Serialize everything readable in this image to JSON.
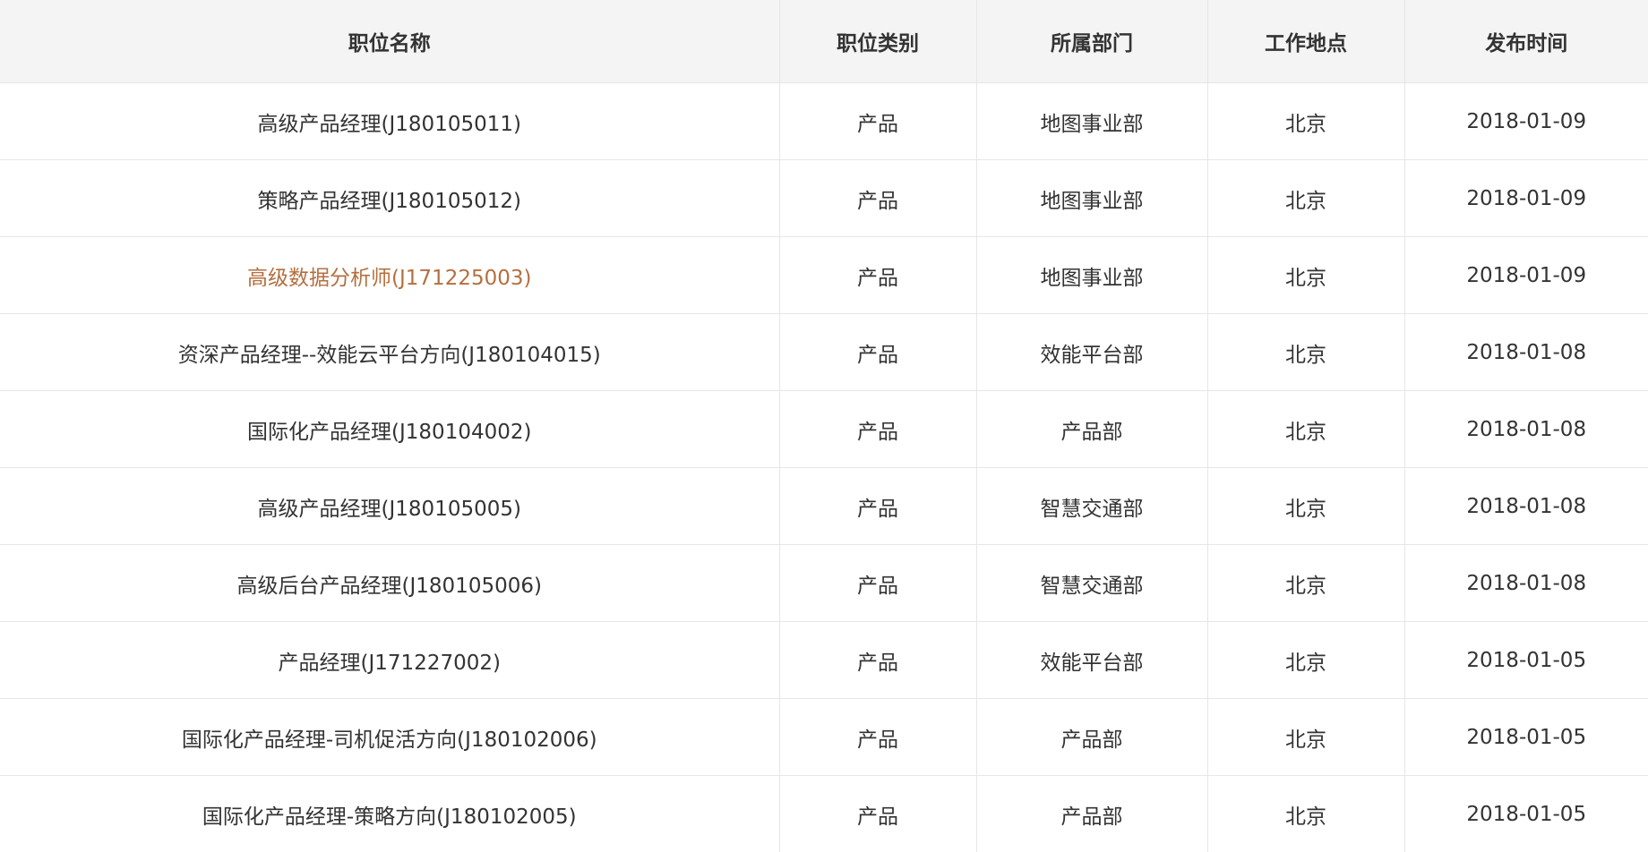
{
  "table": {
    "headers": [
      "职位名称",
      "职位类别",
      "所属部门",
      "工作地点",
      "发布时间"
    ],
    "rows": [
      {
        "title": "高级产品经理(J180105011)",
        "category": "产品",
        "department": "地图事业部",
        "location": "北京",
        "date": "2018-01-09"
      },
      {
        "title": "策略产品经理(J180105012)",
        "category": "产品",
        "department": "地图事业部",
        "location": "北京",
        "date": "2018-01-09"
      },
      {
        "title": "高级数据分析师(J171225003)",
        "category": "产品",
        "department": "地图事业部",
        "location": "北京",
        "date": "2018-01-09"
      },
      {
        "title": "资深产品经理--效能云平台方向(J180104015)",
        "category": "产品",
        "department": "效能平台部",
        "location": "北京",
        "date": "2018-01-08"
      },
      {
        "title": "国际化产品经理(J180104002)",
        "category": "产品",
        "department": "产品部",
        "location": "北京",
        "date": "2018-01-08"
      },
      {
        "title": "高级产品经理(J180105005)",
        "category": "产品",
        "department": "智慧交通部",
        "location": "北京",
        "date": "2018-01-08"
      },
      {
        "title": "高级后台产品经理(J180105006)",
        "category": "产品",
        "department": "智慧交通部",
        "location": "北京",
        "date": "2018-01-08"
      },
      {
        "title": "产品经理(J171227002)",
        "category": "产品",
        "department": "效能平台部",
        "location": "北京",
        "date": "2018-01-05"
      },
      {
        "title": "国际化产品经理-司机促活方向(J180102006)",
        "category": "产品",
        "department": "产品部",
        "location": "北京",
        "date": "2018-01-05"
      },
      {
        "title": "国际化产品经理-策略方向(J180102005)",
        "category": "产品",
        "department": "产品部",
        "location": "北京",
        "date": "2018-01-05"
      }
    ]
  },
  "colors": {
    "header_bg": "#f4f4f4",
    "text": "#333333",
    "hover_link": "#b56f3e",
    "border": "#e6e6e6"
  }
}
